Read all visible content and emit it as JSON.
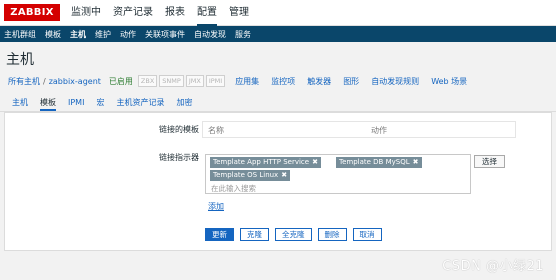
{
  "logo": "ZABBIX",
  "top_nav": [
    "监测中",
    "资产记录",
    "报表",
    "配置",
    "管理"
  ],
  "sub_nav": [
    "主机群组",
    "模板",
    "主机",
    "维护",
    "动作",
    "关联项事件",
    "自动发现",
    "服务"
  ],
  "page_title": "主机",
  "host_bar": {
    "all_hosts": "所有主机",
    "separator": "/",
    "host_name": "zabbix-agent",
    "status": "已启用",
    "tags": [
      "ZBX",
      "SNMP",
      "JMX",
      "IPMI"
    ],
    "links": [
      "应用集",
      "监控项",
      "触发器",
      "图形",
      "自动发现规则",
      "Web 场景"
    ]
  },
  "tabs": [
    "主机",
    "模板",
    "IPMI",
    "宏",
    "主机资产记录",
    "加密"
  ],
  "form": {
    "linked_templates_label": "链接的模板",
    "linked_col_name": "名称",
    "linked_col_action": "动作",
    "link_indicator_label": "链接指示器",
    "chips": [
      "Template App HTTP Service",
      "Template DB MySQL",
      "Template OS Linux"
    ],
    "chip_remove": "✖",
    "search_placeholder": "在此输入搜索",
    "select_button": "选择",
    "add_link": "添加"
  },
  "buttons": [
    "更新",
    "克隆",
    "全克隆",
    "删除",
    "取消"
  ],
  "watermark": "CSDN @小绿21",
  "colors": {
    "brand": "#d40000",
    "nav_bar": "#0a466a",
    "link": "#1565c0",
    "enabled": "#2e7d32",
    "chip": "#768d99"
  }
}
